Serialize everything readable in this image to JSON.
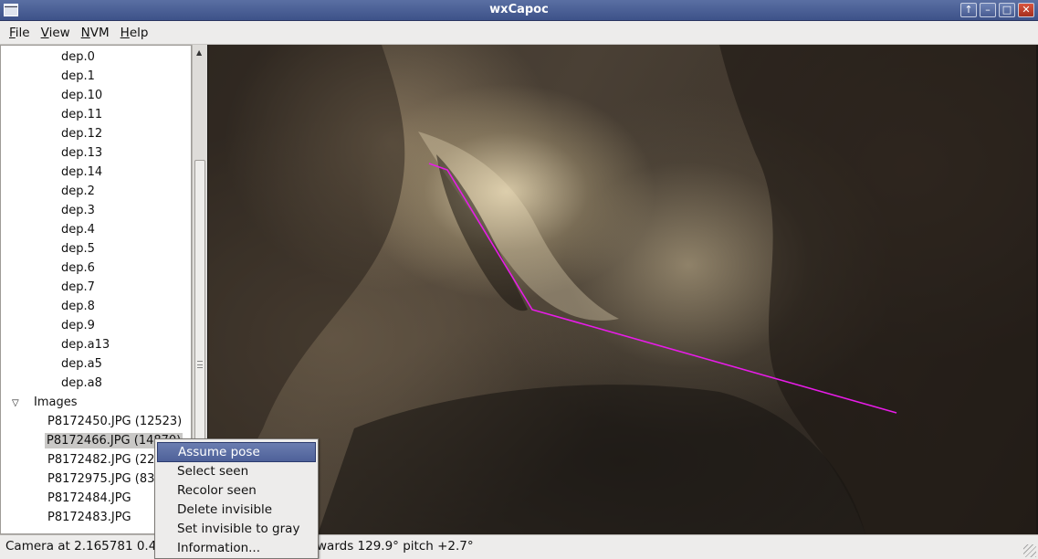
{
  "window": {
    "title": "wxCapoc",
    "buttons": [
      "up-arrow",
      "minimize",
      "maximize",
      "close"
    ]
  },
  "menubar": {
    "items": [
      {
        "label": "File",
        "mnemonic": "F",
        "rest": "ile"
      },
      {
        "label": "View",
        "mnemonic": "V",
        "rest": "iew"
      },
      {
        "label": "NVM",
        "mnemonic": "N",
        "rest": "VM"
      },
      {
        "label": "Help",
        "mnemonic": "H",
        "rest": "elp"
      }
    ]
  },
  "tree": {
    "dep_items": [
      "dep.0",
      "dep.1",
      "dep.10",
      "dep.11",
      "dep.12",
      "dep.13",
      "dep.14",
      "dep.2",
      "dep.3",
      "dep.4",
      "dep.5",
      "dep.6",
      "dep.7",
      "dep.8",
      "dep.9",
      "dep.a13",
      "dep.a5",
      "dep.a8"
    ],
    "images_label": "Images",
    "image_items": [
      "P8172450.JPG (12523)",
      "P8172466.JPG (14870)",
      "P8172482.JPG (22",
      "P8172975.JPG (830",
      "P8172484.JPG",
      "P8172483.JPG"
    ],
    "selected_image_index": 1
  },
  "context_menu": {
    "items": [
      "Assume pose",
      "Select seen",
      "Recolor seen",
      "Delete invisible",
      "Set invisible to gray",
      "Information..."
    ],
    "active_index": 0
  },
  "statusbar": {
    "text": "Camera at 2.165781 0.46",
    "text_right": "wards 129.9° pitch +2.7°"
  },
  "colors": {
    "path_line": "#e81ce8",
    "titlebar": "#4a5f96",
    "menu_highlight": "#5a6da5"
  }
}
